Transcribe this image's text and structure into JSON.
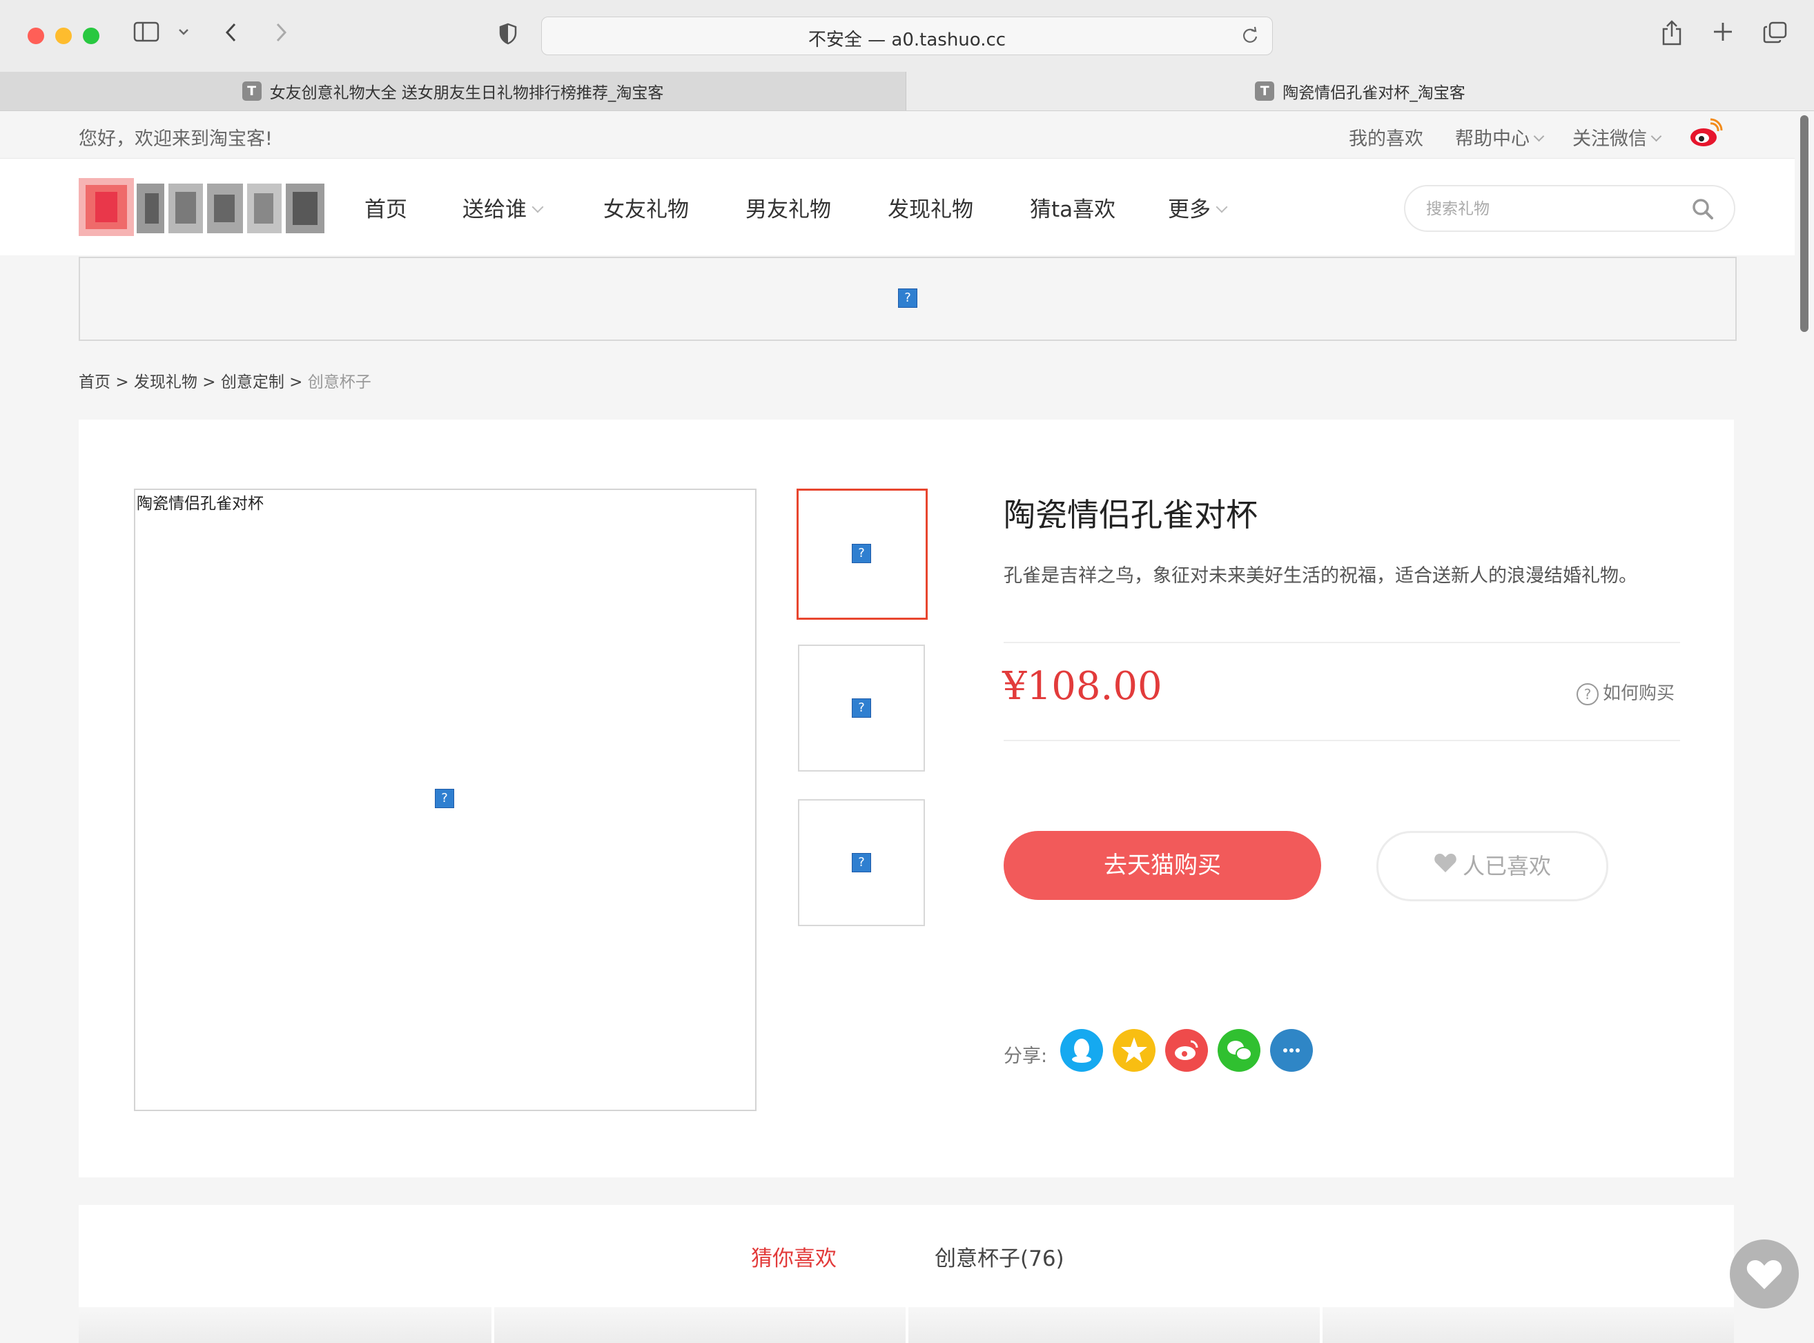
{
  "browser": {
    "url": "不安全 — a0.tashuo.cc",
    "tabs": [
      {
        "favicon": "T",
        "title": "女友创意礼物大全 送女朋友生日礼物排行榜推荐_淘宝客"
      },
      {
        "favicon": "T",
        "title": "陶瓷情侣孔雀对杯_淘宝客"
      }
    ]
  },
  "topbar": {
    "greeting": "您好，欢迎来到淘宝客!",
    "links": [
      "我的喜欢",
      "帮助中心",
      "关注微信"
    ]
  },
  "nav": {
    "items": [
      "首页",
      "送给谁",
      "女友礼物",
      "男友礼物",
      "发现礼物",
      "猜ta喜欢",
      "更多"
    ],
    "search_placeholder": "搜索礼物"
  },
  "breadcrumb": {
    "items": [
      "首页",
      "发现礼物",
      "创意定制"
    ],
    "current": "创意杯子",
    "separator": ">"
  },
  "product": {
    "image_alt": "陶瓷情侣孔雀对杯",
    "title": "陶瓷情侣孔雀对杯",
    "description": "孔雀是吉祥之鸟，象征对未来美好生活的祝福，适合送新人的浪漫结婚礼物。",
    "price": "¥108.00",
    "how_to_buy": "如何购买",
    "buy_button": "去天猫购买",
    "like_button": "人已喜欢",
    "share_label": "分享:"
  },
  "tabs_section": {
    "active": "猜你喜欢",
    "other": "创意杯子(76)"
  },
  "broken_image_glyph": "?",
  "colors": {
    "accent": "#f25a5a",
    "price": "#e23b3b",
    "thumb_active_border": "#e8462f",
    "share_qq": "#15a9f0",
    "share_qzone": "#f8be12",
    "share_weibo": "#ef4b4b",
    "share_wechat": "#30c030",
    "share_more": "#2f86c6"
  }
}
